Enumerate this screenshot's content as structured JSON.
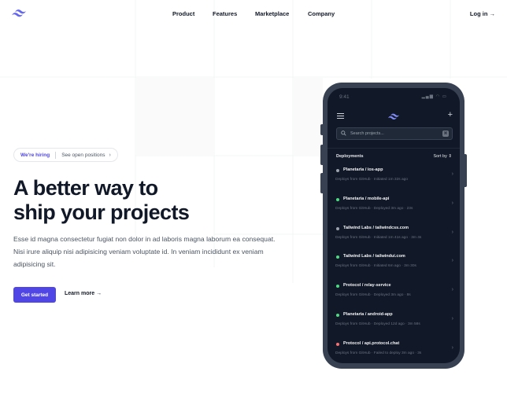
{
  "header": {
    "logo": "tailwind-logo",
    "nav": [
      "Product",
      "Features",
      "Marketplace",
      "Company"
    ],
    "login": "Log in →"
  },
  "hero": {
    "badge_highlight": "We're hiring",
    "badge_text": "See open positions",
    "badge_chevron": "›",
    "headline_line1": "A better way to",
    "headline_line2": "ship your projects",
    "paragraph": "Esse id magna consectetur fugiat non dolor in ad laboris magna laborum ea consequat. Nisi irure aliquip nisi adipisicing veniam voluptate id. In veniam incididunt ex veniam adipisicing sit.",
    "primary_button": "Get started",
    "secondary_link": "Learn more →"
  },
  "phone": {
    "time": "9:41",
    "status_icons": "▂▄▆ ◠ ▭",
    "plus": "+",
    "search_placeholder": "Search projects...",
    "search_shortcut": "⌘",
    "deployments_title": "Deployments",
    "sort_label": "Sort by ⇕",
    "deployments": [
      {
        "project": "Planetaria / ios-app",
        "meta": "Deploys from GitHub · Initiated 1m 32s ago",
        "status": "pending",
        "color": "#9ca3af"
      },
      {
        "project": "Planetaria / mobile-api",
        "meta": "Deploys from GitHub · Deployed 3m ago · 23s",
        "status": "deployed",
        "color": "#4ade80"
      },
      {
        "project": "Tailwind Labs / tailwindcss.com",
        "meta": "Deploys from GitHub · Initiated 1m 41s ago · 3m 4s",
        "status": "pending",
        "color": "#9ca3af"
      },
      {
        "project": "Tailwind Labs / tailwindui.com",
        "meta": "Deploys from GitHub · Initiated 6m ago · 3m 30s",
        "status": "deployed",
        "color": "#4ade80"
      },
      {
        "project": "Protocol / relay-service",
        "meta": "Deploys from GitHub · Deployed 3m ago · 8s",
        "status": "deployed",
        "color": "#4ade80"
      },
      {
        "project": "Planetaria / android-app",
        "meta": "Deploys from GitHub · Deployed 12d ago · 3m 58s",
        "status": "deployed",
        "color": "#4ade80"
      },
      {
        "project": "Protocol / api.protocol.chat",
        "meta": "Deploys from GitHub · Failed to deploy 3m ago · 3s",
        "status": "error",
        "color": "#f87171"
      }
    ]
  },
  "colors": {
    "accent": "#4f46e5",
    "logo": "#6366f1",
    "phone_frame": "#374151",
    "screen": "#111827"
  }
}
